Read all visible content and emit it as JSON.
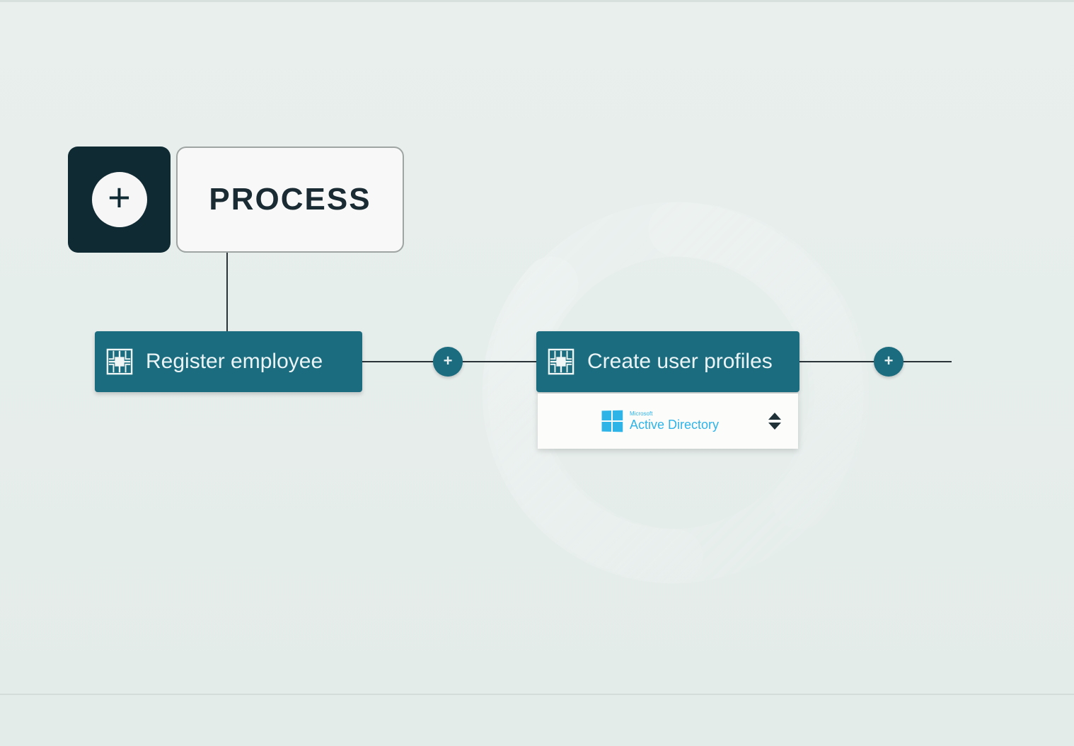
{
  "header": {
    "process_label": "PROCESS"
  },
  "steps": [
    {
      "label": "Register employee"
    },
    {
      "label": "Create user profiles"
    }
  ],
  "dropdown": {
    "vendor": "Microsoft",
    "product": "Active Directory"
  },
  "colors": {
    "background": "#e8efed",
    "card_bg": "#1a6c7e",
    "dark_btn": "#0f2a33",
    "accent": "#2fb4e8"
  }
}
